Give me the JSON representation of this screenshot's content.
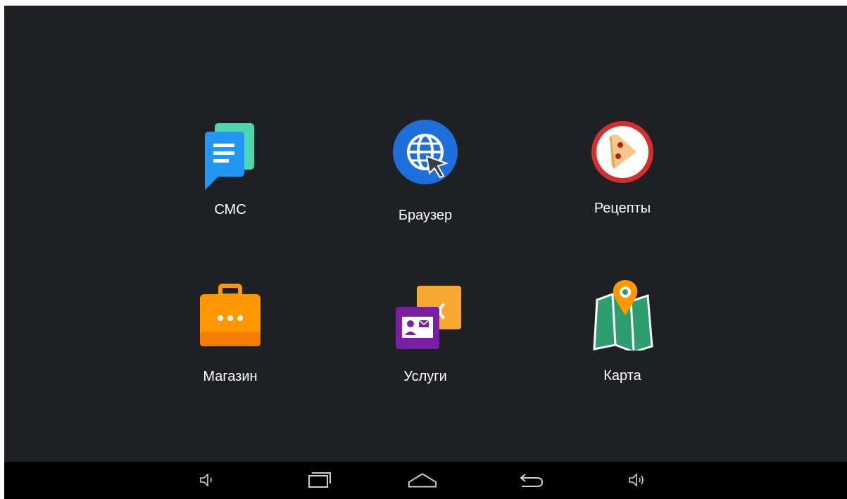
{
  "apps": [
    {
      "label": "СМС",
      "icon": "chat-icon"
    },
    {
      "label": "Браузер",
      "icon": "globe-cursor-icon"
    },
    {
      "label": "Рецепты",
      "icon": "pizza-icon"
    },
    {
      "label": "Магазин",
      "icon": "briefcase-icon"
    },
    {
      "label": "Услуги",
      "icon": "contact-cards-icon"
    },
    {
      "label": "Карта",
      "icon": "map-pin-icon"
    }
  ],
  "navbar": {
    "buttons": [
      "volume-down-icon",
      "recent-apps-icon",
      "home-icon",
      "back-icon",
      "volume-up-icon"
    ]
  },
  "colors": {
    "background": "#1e2024",
    "navbar": "#000000",
    "chat_blue": "#2196f3",
    "chat_teal": "#4dd6b0",
    "globe_blue": "#1e6fd9",
    "pizza_red": "#d32f2f",
    "briefcase_orange": "#ff9800",
    "services_purple": "#7b1fa2",
    "map_green": "#2e9e6e"
  }
}
